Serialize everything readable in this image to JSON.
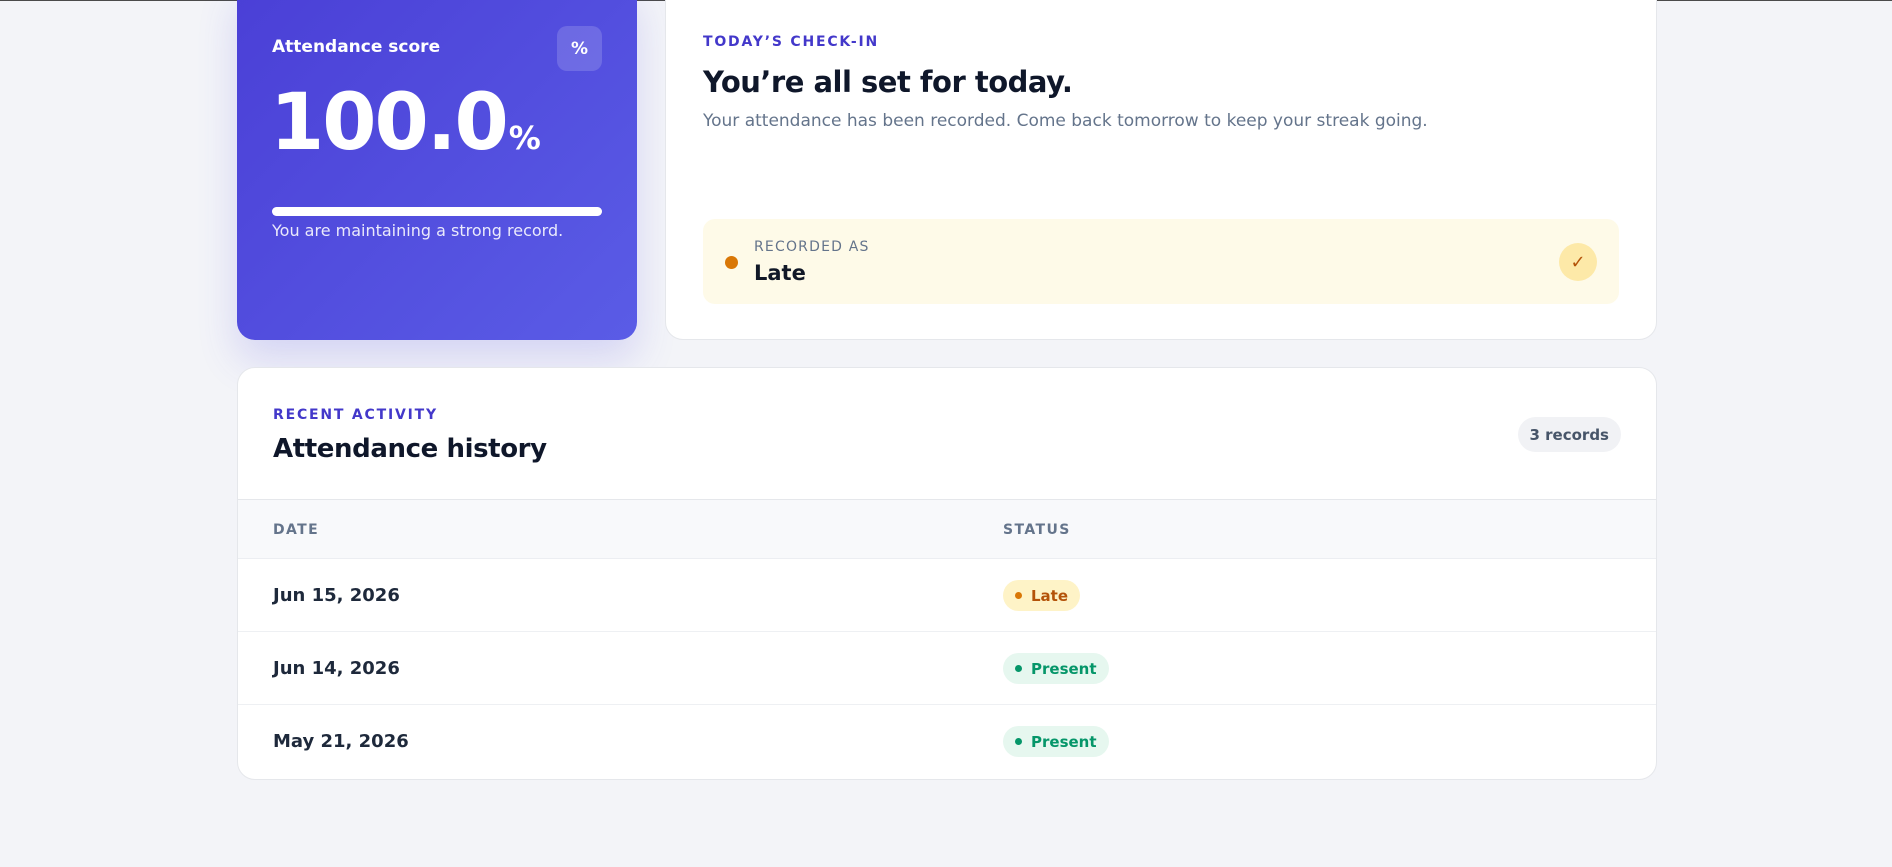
{
  "score": {
    "title": "Attendance score",
    "badge": "%",
    "value": "100.0",
    "unit": "%",
    "progress_fraction": 1.0,
    "note": "You are maintaining a strong record."
  },
  "checkin": {
    "eyebrow": "TODAY’S CHECK-IN",
    "title": "You’re all set for today.",
    "subtitle": "Your attendance has been recorded. Come back tomorrow to keep your streak going.",
    "recorded_label": "RECORDED AS",
    "recorded_value": "Late",
    "check_glyph": "✓"
  },
  "history": {
    "eyebrow": "RECENT ACTIVITY",
    "title": "Attendance history",
    "count": "3 records",
    "columns": [
      "DATE",
      "STATUS"
    ],
    "rows": [
      {
        "date": "Jun 15, 2026",
        "status": "Late"
      },
      {
        "date": "Jun 14, 2026",
        "status": "Present"
      },
      {
        "date": "May 21, 2026",
        "status": "Present"
      }
    ]
  },
  "colors": {
    "accent": "#4338ca",
    "late": "#d97706",
    "present": "#059669"
  }
}
